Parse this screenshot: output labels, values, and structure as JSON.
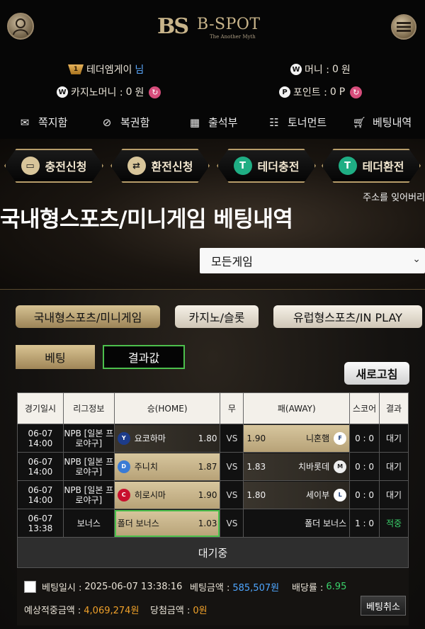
{
  "header": {
    "logo_mark": "BS",
    "logo_text": "B-SPOT",
    "logo_sub": "The Another Myth"
  },
  "user": {
    "level_badge": "1",
    "name": "테더엠게이",
    "honorific": "님",
    "money_label": "머니 : ",
    "money_value": "0",
    "money_unit": " 원",
    "casino_label": "카지노머니 : ",
    "casino_value": "0",
    "casino_unit": " 원",
    "point_label": "포인트 : ",
    "point_value": "0",
    "point_unit": " P",
    "money_icon": "W",
    "point_icon": "P"
  },
  "quicknav": [
    {
      "label": "쪽지함",
      "icon": "envelope-icon"
    },
    {
      "label": "복권함",
      "icon": "ticket-icon"
    },
    {
      "label": "출석부",
      "icon": "calendar-icon"
    },
    {
      "label": "토너먼트",
      "icon": "tournament-icon"
    },
    {
      "label": "베팅내역",
      "icon": "cart-icon"
    }
  ],
  "action_buttons": [
    {
      "label": "충전신청"
    },
    {
      "label": "환전신청"
    },
    {
      "label": "테더충전"
    },
    {
      "label": "테더환전"
    }
  ],
  "marquee": "주소를 잊어버리",
  "page_title": "국내형스포츠/미니게임 베팅내역",
  "game_filter": {
    "selected": "모든게임"
  },
  "category_tabs": [
    {
      "label": "국내형스포츠/미니게임",
      "active": true
    },
    {
      "label": "카지노/슬롯",
      "active": false
    },
    {
      "label": "유럽형스포츠/IN PLAY",
      "active": false
    }
  ],
  "sub_tabs": {
    "bet": "베팅",
    "result": "결과값"
  },
  "refresh_label": "새로고침",
  "table": {
    "headers": [
      "경기일시",
      "리그정보",
      "승(HOME)",
      "무",
      "패(AWAY)",
      "스코어",
      "결과"
    ],
    "rows": [
      {
        "date": "06-07",
        "time": "14:00",
        "league1": "NPB [일본 프",
        "league2": "로야구]",
        "home": "요코하마",
        "home_odds": "1.80",
        "draw": "VS",
        "away": "니혼햄",
        "away_odds": "1.90",
        "score": "0 : 0",
        "result": "대기"
      },
      {
        "date": "06-07",
        "time": "14:00",
        "league1": "NPB [일본 프",
        "league2": "로야구]",
        "home": "주니치",
        "home_odds": "1.87",
        "draw": "VS",
        "away": "치바롯데",
        "away_odds": "1.83",
        "score": "0 : 0",
        "result": "대기"
      },
      {
        "date": "06-07",
        "time": "14:00",
        "league1": "NPB [일본 프",
        "league2": "로야구]",
        "home": "히로시마",
        "home_odds": "1.90",
        "draw": "VS",
        "away": "세이부",
        "away_odds": "1.80",
        "score": "0 : 0",
        "result": "대기"
      },
      {
        "date": "06-07",
        "time": "13:38",
        "league1": "보너스",
        "league2": "",
        "home": "폴더 보너스",
        "home_odds": "1.03",
        "draw": "VS",
        "away": "폴더 보너스",
        "away_odds": "",
        "score": "1 : 0",
        "result": "적중"
      }
    ]
  },
  "status": "대기중",
  "summary": {
    "bet_time_label": "베팅일시 : ",
    "bet_time": "2025-06-07 13:38:16",
    "bet_amount_label": "베팅금액 : ",
    "bet_amount": "585,507원",
    "odds_label": "배당률 : ",
    "odds": "6.95",
    "expected_label": "예상적중금액 : ",
    "expected": "4,069,274원",
    "win_label": "당첨금액 : ",
    "win": "0원",
    "cancel_label": "베팅취소"
  }
}
